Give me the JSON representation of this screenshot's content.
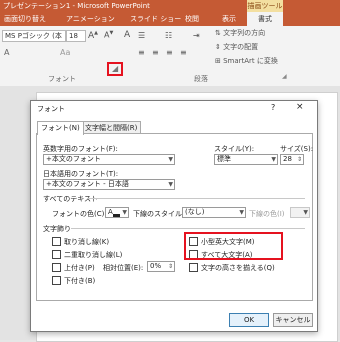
{
  "window": {
    "title": "プレゼンテーション1 - Microsoft PowerPoint",
    "context_tab": "描画ツール"
  },
  "ribbon_tabs": [
    "画面切り替え",
    "アニメーション",
    "スライド ショー",
    "校閲",
    "表示",
    "書式"
  ],
  "ribbon": {
    "font_name": "MS Pゴシック (本",
    "font_size": "18",
    "text_direction": "文字列の方向",
    "align_text": "文字の配置",
    "smartart": "SmartArt に変換",
    "font_group": "フォント",
    "paragraph_group": "段落"
  },
  "dialog": {
    "title": "フォント",
    "help": "?",
    "close": "×",
    "tabs": [
      "フォント(N)",
      "文字幅と間隔(R)"
    ],
    "western_font_label": "英数字用のフォント(F):",
    "western_font_value": "+本文のフォント",
    "style_label": "スタイル(Y):",
    "style_value": "標準",
    "size_label": "サイズ(S):",
    "size_value": "28",
    "asian_font_label": "日本語用のフォント(T):",
    "asian_font_value": "+本文のフォント - 日本語",
    "all_text_label": "すべてのテキスト",
    "font_color_label": "フォントの色(C)",
    "underline_style_label": "下線のスタイル(U)",
    "underline_style_value": "(なし)",
    "underline_color_label": "下線の色(I)",
    "effects_label": "文字飾り",
    "effects": {
      "strike": "取り消し線(K)",
      "double_strike": "二重取り消し線(L)",
      "superscript": "上付き(P)",
      "offset_label": "相対位置(E):",
      "offset_value": "0%",
      "subscript": "下付き(B)",
      "small_caps": "小型英大文字(M)",
      "all_caps": "すべて大文字(A)",
      "equalize": "文字の高さを揃える(Q)"
    },
    "ok": "OK",
    "cancel": "キャンセル"
  },
  "colors": {
    "ribbon_orange": "#c55a34",
    "highlight_red": "#e5121f"
  }
}
